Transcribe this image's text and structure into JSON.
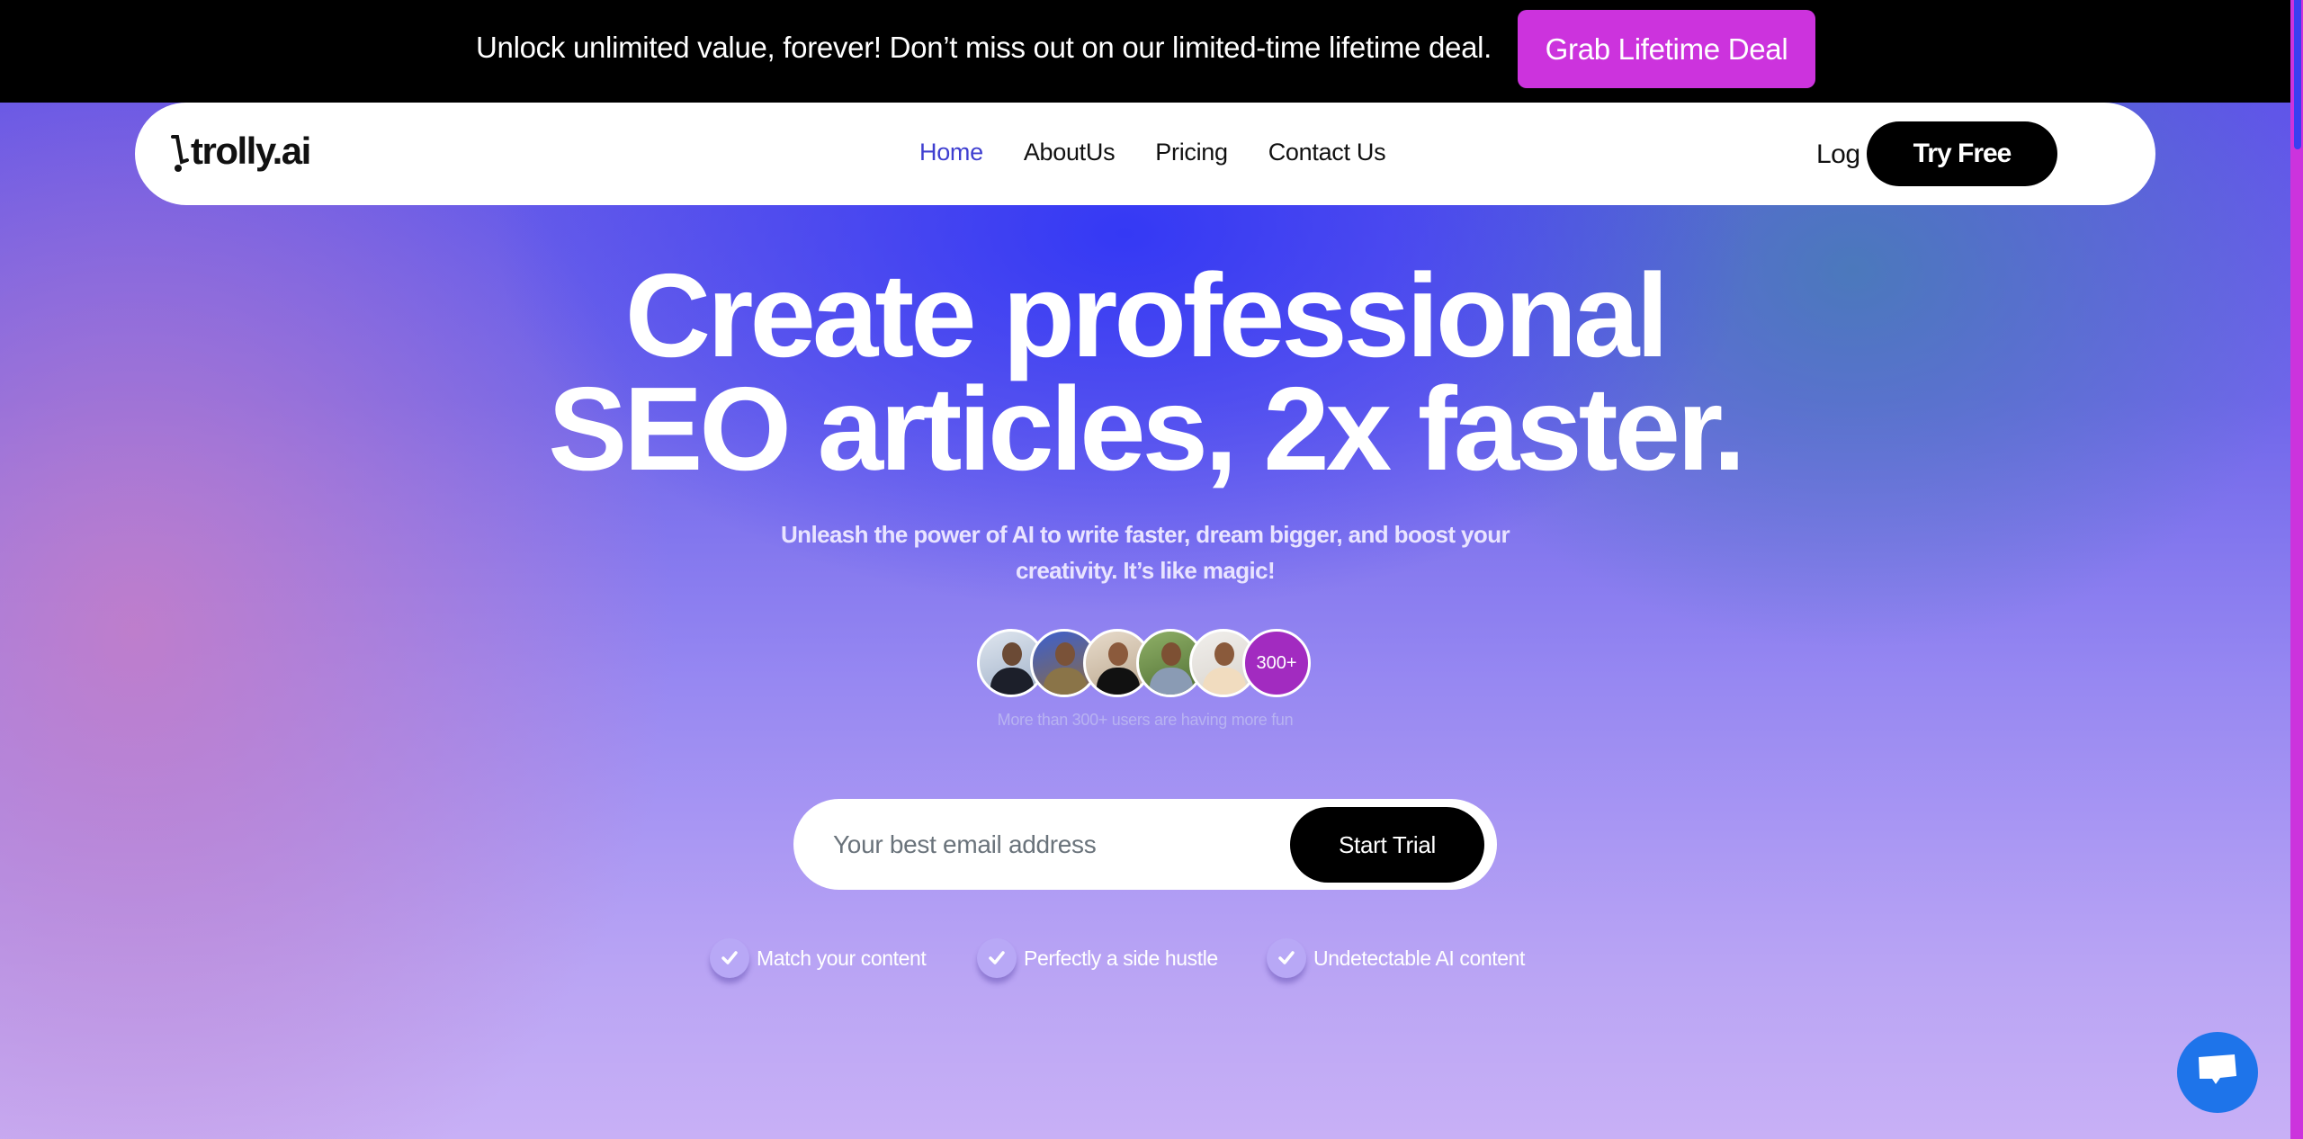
{
  "promo": {
    "text": "Unlock unlimited value, forever! Don’t miss out on our limited-time lifetime deal.",
    "button_label": "Grab Lifetime Deal"
  },
  "nav": {
    "logo_text": "trolly.ai",
    "links": [
      {
        "label": "Home",
        "active": true
      },
      {
        "label": "AboutUs",
        "active": false
      },
      {
        "label": "Pricing",
        "active": false
      },
      {
        "label": "Contact Us",
        "active": false
      }
    ],
    "login_label": "Log in",
    "cta_label": "Try Free"
  },
  "hero": {
    "headline_line1": "Create professional",
    "headline_line2": "SEO articles, 2x faster.",
    "subheadline": "Unleash the power of AI to write faster, dream bigger, and boost your creativity. It’s like magic!",
    "avatars_count_label": "300+",
    "users_caption": "More than 300+ users are having more fun"
  },
  "signup": {
    "email_placeholder": "Your best email address",
    "email_value": "",
    "button_label": "Start Trial"
  },
  "features": [
    {
      "label": "Match your content"
    },
    {
      "label": "Perfectly a side hustle"
    },
    {
      "label": "Undetectable AI content"
    }
  ],
  "colors": {
    "promo_button": "#cc33dd",
    "nav_active": "#3f3fd0",
    "chat_button": "#1e74ea",
    "avatar_count_bg": "#a22bc0"
  },
  "icons": {
    "chat": "chat-bubble-icon",
    "check": "check-icon"
  }
}
